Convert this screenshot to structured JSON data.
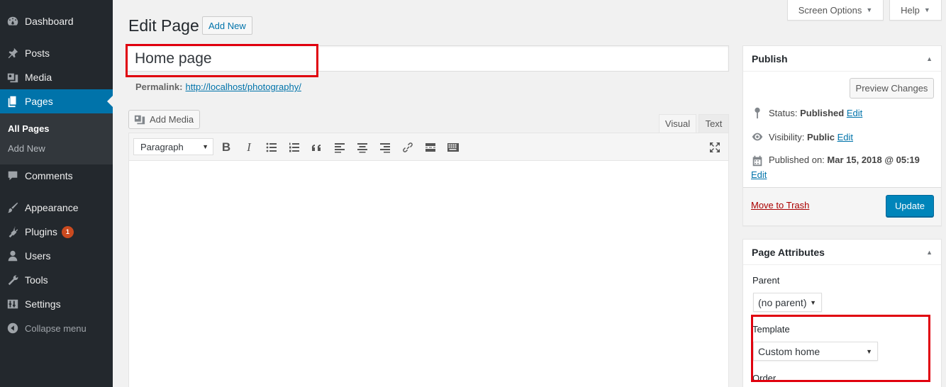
{
  "sidebar": {
    "items": [
      {
        "label": "Dashboard",
        "icon": "dashboard-icon"
      },
      {
        "label": "Posts",
        "icon": "pin-icon"
      },
      {
        "label": "Media",
        "icon": "media-icon"
      },
      {
        "label": "Pages",
        "icon": "pages-icon"
      },
      {
        "label": "Comments",
        "icon": "comment-icon"
      },
      {
        "label": "Appearance",
        "icon": "brush-icon"
      },
      {
        "label": "Plugins",
        "icon": "plugin-icon",
        "badge": "1"
      },
      {
        "label": "Users",
        "icon": "user-icon"
      },
      {
        "label": "Tools",
        "icon": "wrench-icon"
      },
      {
        "label": "Settings",
        "icon": "settings-icon"
      }
    ],
    "submenu": [
      "All Pages",
      "Add New"
    ],
    "collapse_label": "Collapse menu"
  },
  "screen_tabs": {
    "screen_options": "Screen Options",
    "help": "Help"
  },
  "header": {
    "title": "Edit Page",
    "add_new": "Add New"
  },
  "title_field": {
    "value": "Home page"
  },
  "permalink": {
    "label": "Permalink:",
    "url": "http://localhost/photography/"
  },
  "editor": {
    "add_media": "Add Media",
    "tabs": {
      "visual": "Visual",
      "text": "Text"
    },
    "format_select": "Paragraph",
    "toolbar_icons": [
      "bold-icon",
      "italic-icon",
      "bullet-list-icon",
      "numbered-list-icon",
      "blockquote-icon",
      "align-left-icon",
      "align-center-icon",
      "align-right-icon",
      "link-icon",
      "read-more-icon",
      "toolbar-toggle-icon",
      "fullscreen-icon"
    ]
  },
  "publish": {
    "title": "Publish",
    "preview": "Preview Changes",
    "status_label": "Status:",
    "status_value": "Published",
    "visibility_label": "Visibility:",
    "visibility_value": "Public",
    "published_label": "Published on:",
    "published_value": "Mar 15, 2018 @ 05:19",
    "edit": "Edit",
    "trash": "Move to Trash",
    "update": "Update"
  },
  "page_attributes": {
    "title": "Page Attributes",
    "parent_label": "Parent",
    "parent_value": "(no parent)",
    "template_label": "Template",
    "template_value": "Custom home",
    "order_label": "Order"
  },
  "colors": {
    "accent": "#0073aa",
    "sidebar_bg": "#23282d",
    "highlight": "#e0000e",
    "primary_button": "#0085ba"
  }
}
